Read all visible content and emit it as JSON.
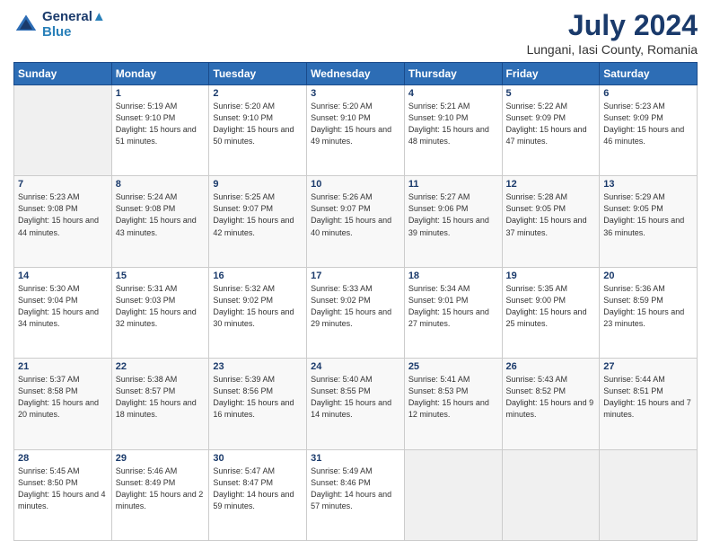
{
  "header": {
    "logo_line1": "General",
    "logo_line2": "Blue",
    "month_title": "July 2024",
    "location": "Lungani, Iasi County, Romania"
  },
  "days_of_week": [
    "Sunday",
    "Monday",
    "Tuesday",
    "Wednesday",
    "Thursday",
    "Friday",
    "Saturday"
  ],
  "weeks": [
    [
      {
        "num": "",
        "empty": true
      },
      {
        "num": "1",
        "sunrise": "5:19 AM",
        "sunset": "9:10 PM",
        "daylight": "15 hours and 51 minutes."
      },
      {
        "num": "2",
        "sunrise": "5:20 AM",
        "sunset": "9:10 PM",
        "daylight": "15 hours and 50 minutes."
      },
      {
        "num": "3",
        "sunrise": "5:20 AM",
        "sunset": "9:10 PM",
        "daylight": "15 hours and 49 minutes."
      },
      {
        "num": "4",
        "sunrise": "5:21 AM",
        "sunset": "9:10 PM",
        "daylight": "15 hours and 48 minutes."
      },
      {
        "num": "5",
        "sunrise": "5:22 AM",
        "sunset": "9:09 PM",
        "daylight": "15 hours and 47 minutes."
      },
      {
        "num": "6",
        "sunrise": "5:23 AM",
        "sunset": "9:09 PM",
        "daylight": "15 hours and 46 minutes."
      }
    ],
    [
      {
        "num": "7",
        "sunrise": "5:23 AM",
        "sunset": "9:08 PM",
        "daylight": "15 hours and 44 minutes."
      },
      {
        "num": "8",
        "sunrise": "5:24 AM",
        "sunset": "9:08 PM",
        "daylight": "15 hours and 43 minutes."
      },
      {
        "num": "9",
        "sunrise": "5:25 AM",
        "sunset": "9:07 PM",
        "daylight": "15 hours and 42 minutes."
      },
      {
        "num": "10",
        "sunrise": "5:26 AM",
        "sunset": "9:07 PM",
        "daylight": "15 hours and 40 minutes."
      },
      {
        "num": "11",
        "sunrise": "5:27 AM",
        "sunset": "9:06 PM",
        "daylight": "15 hours and 39 minutes."
      },
      {
        "num": "12",
        "sunrise": "5:28 AM",
        "sunset": "9:05 PM",
        "daylight": "15 hours and 37 minutes."
      },
      {
        "num": "13",
        "sunrise": "5:29 AM",
        "sunset": "9:05 PM",
        "daylight": "15 hours and 36 minutes."
      }
    ],
    [
      {
        "num": "14",
        "sunrise": "5:30 AM",
        "sunset": "9:04 PM",
        "daylight": "15 hours and 34 minutes."
      },
      {
        "num": "15",
        "sunrise": "5:31 AM",
        "sunset": "9:03 PM",
        "daylight": "15 hours and 32 minutes."
      },
      {
        "num": "16",
        "sunrise": "5:32 AM",
        "sunset": "9:02 PM",
        "daylight": "15 hours and 30 minutes."
      },
      {
        "num": "17",
        "sunrise": "5:33 AM",
        "sunset": "9:02 PM",
        "daylight": "15 hours and 29 minutes."
      },
      {
        "num": "18",
        "sunrise": "5:34 AM",
        "sunset": "9:01 PM",
        "daylight": "15 hours and 27 minutes."
      },
      {
        "num": "19",
        "sunrise": "5:35 AM",
        "sunset": "9:00 PM",
        "daylight": "15 hours and 25 minutes."
      },
      {
        "num": "20",
        "sunrise": "5:36 AM",
        "sunset": "8:59 PM",
        "daylight": "15 hours and 23 minutes."
      }
    ],
    [
      {
        "num": "21",
        "sunrise": "5:37 AM",
        "sunset": "8:58 PM",
        "daylight": "15 hours and 20 minutes."
      },
      {
        "num": "22",
        "sunrise": "5:38 AM",
        "sunset": "8:57 PM",
        "daylight": "15 hours and 18 minutes."
      },
      {
        "num": "23",
        "sunrise": "5:39 AM",
        "sunset": "8:56 PM",
        "daylight": "15 hours and 16 minutes."
      },
      {
        "num": "24",
        "sunrise": "5:40 AM",
        "sunset": "8:55 PM",
        "daylight": "15 hours and 14 minutes."
      },
      {
        "num": "25",
        "sunrise": "5:41 AM",
        "sunset": "8:53 PM",
        "daylight": "15 hours and 12 minutes."
      },
      {
        "num": "26",
        "sunrise": "5:43 AM",
        "sunset": "8:52 PM",
        "daylight": "15 hours and 9 minutes."
      },
      {
        "num": "27",
        "sunrise": "5:44 AM",
        "sunset": "8:51 PM",
        "daylight": "15 hours and 7 minutes."
      }
    ],
    [
      {
        "num": "28",
        "sunrise": "5:45 AM",
        "sunset": "8:50 PM",
        "daylight": "15 hours and 4 minutes."
      },
      {
        "num": "29",
        "sunrise": "5:46 AM",
        "sunset": "8:49 PM",
        "daylight": "15 hours and 2 minutes."
      },
      {
        "num": "30",
        "sunrise": "5:47 AM",
        "sunset": "8:47 PM",
        "daylight": "14 hours and 59 minutes."
      },
      {
        "num": "31",
        "sunrise": "5:49 AM",
        "sunset": "8:46 PM",
        "daylight": "14 hours and 57 minutes."
      },
      {
        "num": "",
        "empty": true
      },
      {
        "num": "",
        "empty": true
      },
      {
        "num": "",
        "empty": true
      }
    ]
  ],
  "labels": {
    "sunrise": "Sunrise:",
    "sunset": "Sunset:",
    "daylight": "Daylight:"
  }
}
